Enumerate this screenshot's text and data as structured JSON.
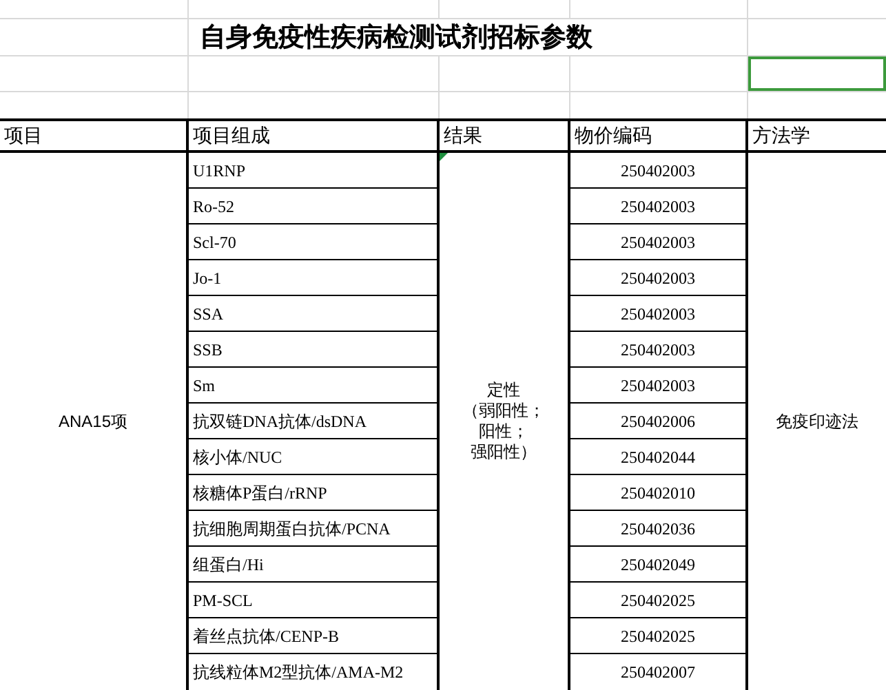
{
  "title": "自身免疫性疾病检测试剂招标参数",
  "blank_row": {
    "cells": [
      {
        "selected": false
      },
      {
        "selected": false
      },
      {
        "selected": false
      },
      {
        "selected": false
      },
      {
        "selected": true
      }
    ]
  },
  "table": {
    "columns": [
      "项目",
      "项目组成",
      "结果",
      "物价编码",
      "方法学"
    ],
    "project": "ANA15项",
    "result": [
      "定性",
      "（弱阳性；",
      "阳性；",
      "强阳性）"
    ],
    "result_marker": true,
    "method": "免疫印迹法",
    "rows": [
      {
        "component": "U1RNP",
        "code": "250402003"
      },
      {
        "component": "Ro-52",
        "code": "250402003"
      },
      {
        "component": "Scl-70",
        "code": "250402003"
      },
      {
        "component": "Jo-1",
        "code": "250402003"
      },
      {
        "component": "SSA",
        "code": "250402003"
      },
      {
        "component": "SSB",
        "code": "250402003"
      },
      {
        "component": "Sm",
        "code": "250402003"
      },
      {
        "component": "抗双链DNA抗体/dsDNA",
        "code": "250402006"
      },
      {
        "component": "核小体/NUC",
        "code": "250402044"
      },
      {
        "component": "核糖体P蛋白/rRNP",
        "code": "250402010"
      },
      {
        "component": "抗细胞周期蛋白抗体/PCNA",
        "code": "250402036"
      },
      {
        "component": "组蛋白/Hi",
        "code": "250402049"
      },
      {
        "component": "PM-SCL",
        "code": "250402025"
      },
      {
        "component": "着丝点抗体/CENP-B",
        "code": "250402025"
      },
      {
        "component": "抗线粒体M2型抗体/AMA-M2",
        "code": "250402007"
      }
    ]
  }
}
